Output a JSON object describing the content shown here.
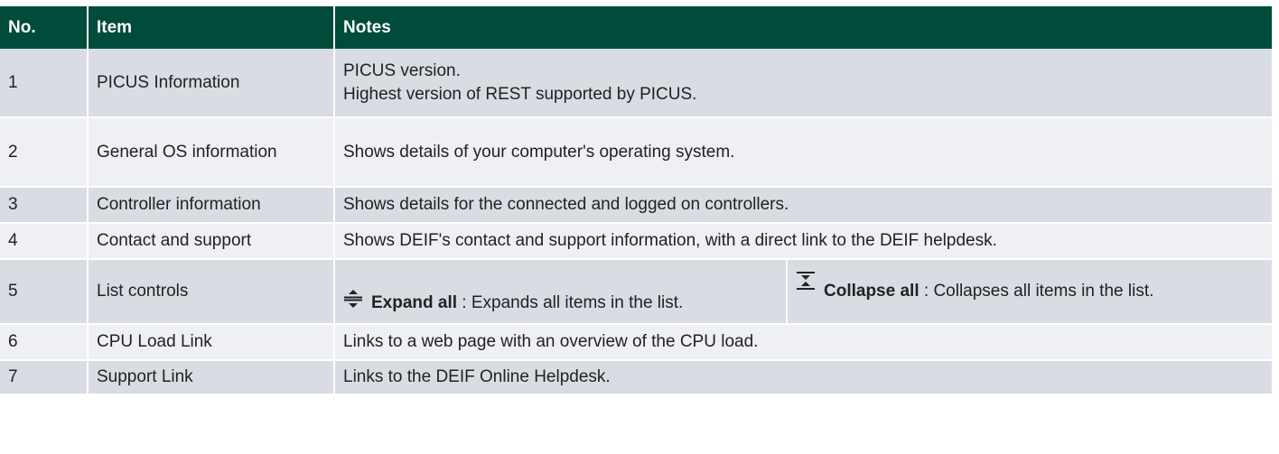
{
  "headers": {
    "no": "No.",
    "item": "Item",
    "notes": "Notes"
  },
  "rows": [
    {
      "no": "1",
      "item": "PICUS Information",
      "notes": [
        "PICUS version.",
        "Highest version of REST supported by PICUS."
      ]
    },
    {
      "no": "2",
      "item": "General OS information",
      "notes": [
        "Shows details of your computer's operating system."
      ]
    },
    {
      "no": "3",
      "item": "Controller information",
      "notes": [
        "Shows details for the connected and logged on controllers."
      ]
    },
    {
      "no": "4",
      "item": "Contact and support",
      "notes": [
        "Shows DEIF's contact and support information, with a direct link to the DEIF helpdesk."
      ]
    },
    {
      "no": "5",
      "item": "List controls",
      "controls": [
        {
          "icon": "expand-all-icon",
          "label": "Expand all",
          "description": " : Expands all items in the list."
        },
        {
          "icon": "collapse-all-icon",
          "label": "Collapse all",
          "description": " : Collapses all items in the list."
        }
      ]
    },
    {
      "no": "6",
      "item": "CPU Load Link",
      "notes": [
        "Links to a web page with an overview of the CPU load."
      ]
    },
    {
      "no": "7",
      "item": "Support Link",
      "notes": [
        "Links to the DEIF Online Helpdesk."
      ]
    }
  ],
  "colors": {
    "header_bg": "#004b3a",
    "row_odd_bg": "#d9dce2",
    "row_even_bg": "#eef0f4"
  }
}
